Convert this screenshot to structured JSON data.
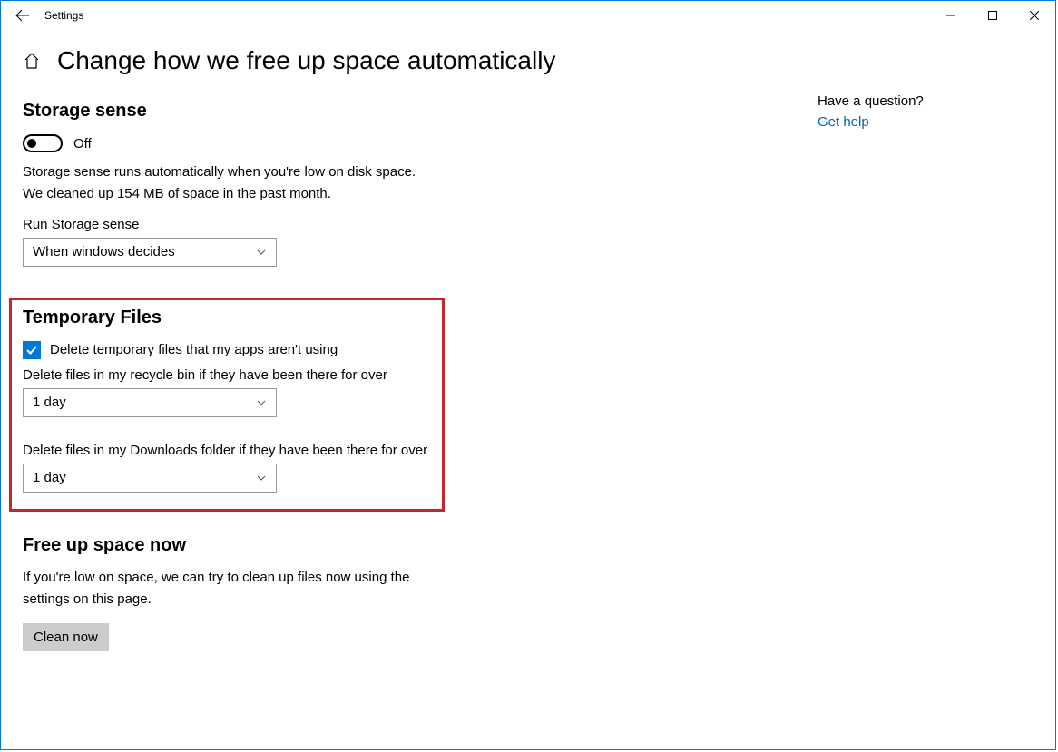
{
  "window": {
    "title": "Settings"
  },
  "page": {
    "title": "Change how we free up space automatically"
  },
  "storage_sense": {
    "heading": "Storage sense",
    "toggle_state": "Off",
    "desc_line1": "Storage sense runs automatically when you're low on disk space.",
    "desc_line2": "We cleaned up 154 MB of space in the past month.",
    "run_label": "Run Storage sense",
    "run_value": "When windows decides"
  },
  "temp_files": {
    "heading": "Temporary Files",
    "checkbox_label": "Delete temporary files that my apps aren't using",
    "checkbox_checked": true,
    "recycle_label": "Delete files in my recycle bin if they have been there for over",
    "recycle_value": "1 day",
    "downloads_label": "Delete files in my Downloads folder if they have been there for over",
    "downloads_value": "1 day"
  },
  "free_up": {
    "heading": "Free up space now",
    "desc_line1": "If you're low on space, we can try to clean up files now using the",
    "desc_line2": "settings on this page.",
    "button": "Clean now"
  },
  "help": {
    "question": "Have a question?",
    "link": "Get help"
  }
}
